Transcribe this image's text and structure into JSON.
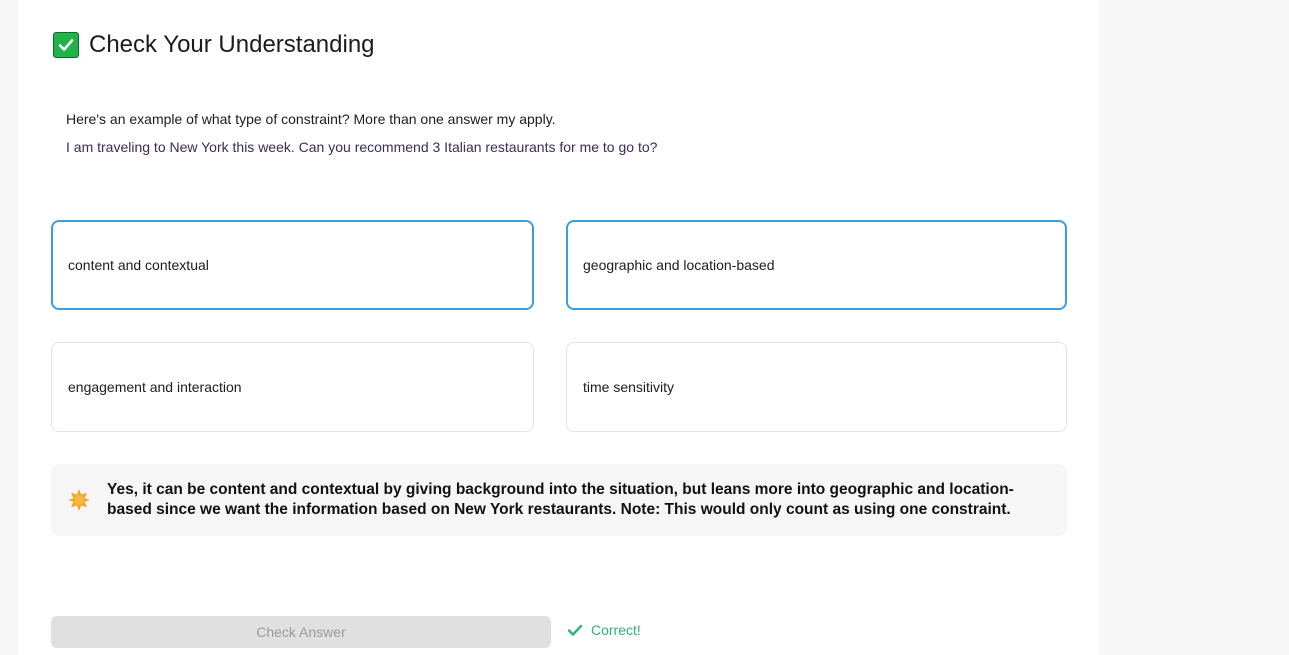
{
  "quiz": {
    "title": "Check Your Understanding",
    "prompt": "Here's an example of what type of constraint? More than one answer my apply.",
    "example": "I am traveling to New York this week. Can you recommend 3 Italian restaurants for me to go to?",
    "options": [
      {
        "label": "content and contextual",
        "selected": true
      },
      {
        "label": "geographic and location-based",
        "selected": true
      },
      {
        "label": "engagement and interaction",
        "selected": false
      },
      {
        "label": "time sensitivity",
        "selected": false
      }
    ],
    "feedback": "Yes, it can be content and contextual by giving background into the situation, but leans more into geographic and location-based since we want the information based on New York restaurants. Note: This would only count as using one constraint.",
    "check_button_label": "Check Answer",
    "status_text": "Correct!"
  },
  "icons": {
    "title_icon": "check-mark-button-icon",
    "feedback_icon": "star-icon",
    "status_icon": "checkmark-icon"
  },
  "colors": {
    "selected_border": "#3a9ee0",
    "correct": "#2bb673",
    "title_check": "#21b24b",
    "star": "#f5a623"
  }
}
